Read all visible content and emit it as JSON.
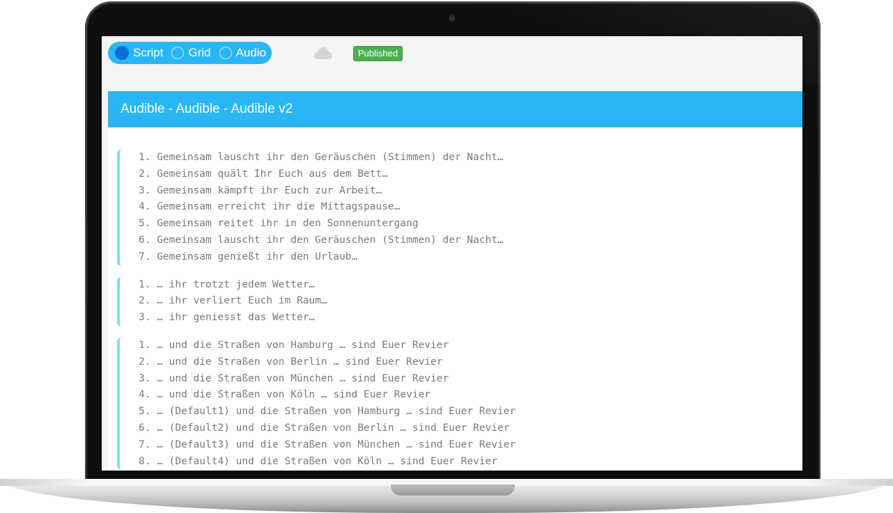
{
  "toolbar": {
    "modes": [
      {
        "label": "Script",
        "selected": true
      },
      {
        "label": "Grid",
        "selected": false
      },
      {
        "label": "Audio",
        "selected": false
      }
    ],
    "cloud_icon": "cloud-icon",
    "status": "Published",
    "status_color": "#4caf50",
    "accent_color": "#29b6f6"
  },
  "card": {
    "title": "Audible - Audible - Audible v2",
    "groups": [
      {
        "lines": [
          "1. Gemeinsam lauscht ihr den Geräuschen (Stimmen) der Nacht…",
          "2. Gemeinsam quält Ihr Euch aus dem Bett…",
          "3. Gemeinsam kämpft ihr Euch zur Arbeit…",
          "4. Gemeinsam erreicht ihr die Mittagspause…",
          "5. Gemeinsam reitet ihr in den Sonnenuntergang",
          "6. Gemeinsam lauscht ihr den Geräuschen (Stimmen) der Nacht…",
          "7. Gemeinsam genießt ihr den Urlaub…"
        ]
      },
      {
        "lines": [
          "1. … ihr trotzt jedem Wetter…",
          "2. … ihr verliert Euch im Raum…",
          "3. … ihr geniesst das Wetter…"
        ]
      },
      {
        "lines": [
          "1. … und die Straßen von Hamburg … sind Euer Revier",
          "2. … und die Straßen von Berlin … sind Euer Revier",
          "3. … und die Straßen von München … sind Euer Revier",
          "4. … und die Straßen von Köln … sind Euer Revier",
          "5. … (Default1) und die Straßen von Hamburg … sind Euer Revier",
          "6. … (Default2) und die Straßen von Berlin … sind Euer Revier",
          "7. … (Default3) und die Straßen von München … sind Euer Revier",
          "8. … (Default4) und die Straßen von Köln … sind Euer Revier"
        ]
      }
    ]
  }
}
